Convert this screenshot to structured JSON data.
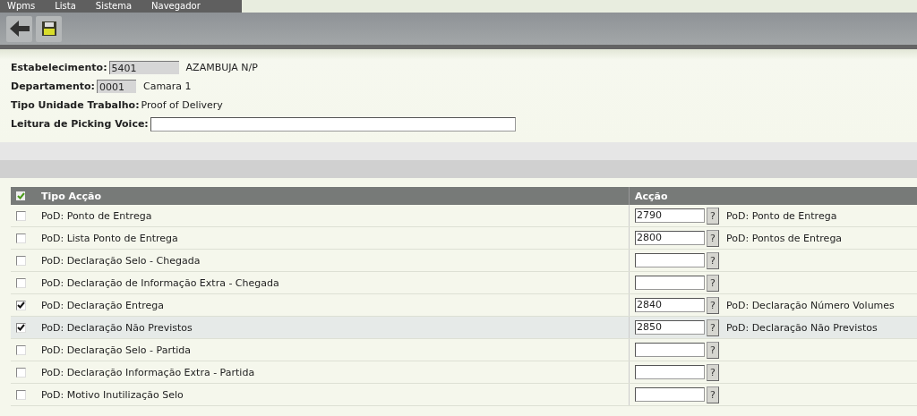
{
  "menu": [
    "Wpms",
    "Lista",
    "Sistema",
    "Navegador"
  ],
  "form": {
    "estabelecimento": {
      "label": "Estabelecimento:",
      "value": "5401",
      "description": "AZAMBUJA N/P"
    },
    "departamento": {
      "label": "Departamento:",
      "value": "0001",
      "description": "Camara 1"
    },
    "tipo_unidade": {
      "label": "Tipo Unidade Trabalho:",
      "value": "Proof of Delivery"
    },
    "leitura": {
      "label": "Leitura de Picking Voice:"
    }
  },
  "table": {
    "select_all_checked": true,
    "columns": [
      "Tipo Acção",
      "Acção"
    ],
    "rows": [
      {
        "checked": false,
        "selected": false,
        "tipo": "PoD: Ponto de Entrega",
        "code": "2790",
        "button": "?",
        "description": "PoD: Ponto de Entrega"
      },
      {
        "checked": false,
        "selected": false,
        "tipo": "PoD: Lista Ponto de Entrega",
        "code": "2800",
        "button": "?",
        "description": "PoD: Pontos de Entrega"
      },
      {
        "checked": false,
        "selected": false,
        "tipo": "PoD: Declaração Selo - Chegada",
        "button": "?"
      },
      {
        "checked": false,
        "selected": false,
        "tipo": "PoD: Declaração de Informação Extra - Chegada",
        "button": "?"
      },
      {
        "checked": true,
        "selected": false,
        "tipo": "PoD: Declaração Entrega",
        "code": "2840",
        "button": "?",
        "description": "PoD: Declaração Número Volumes"
      },
      {
        "checked": true,
        "selected": true,
        "tipo": "PoD: Declaração Não Previstos",
        "code": "2850",
        "button": "?",
        "description": "PoD: Declaração Não Previstos"
      },
      {
        "checked": false,
        "selected": false,
        "tipo": "PoD: Declaração Selo - Partida",
        "button": "?"
      },
      {
        "checked": false,
        "selected": false,
        "tipo": "PoD: Declaração Informação Extra - Partida",
        "button": "?"
      },
      {
        "checked": false,
        "selected": false,
        "tipo": "PoD: Motivo Inutilização Selo",
        "button": "?"
      }
    ]
  }
}
